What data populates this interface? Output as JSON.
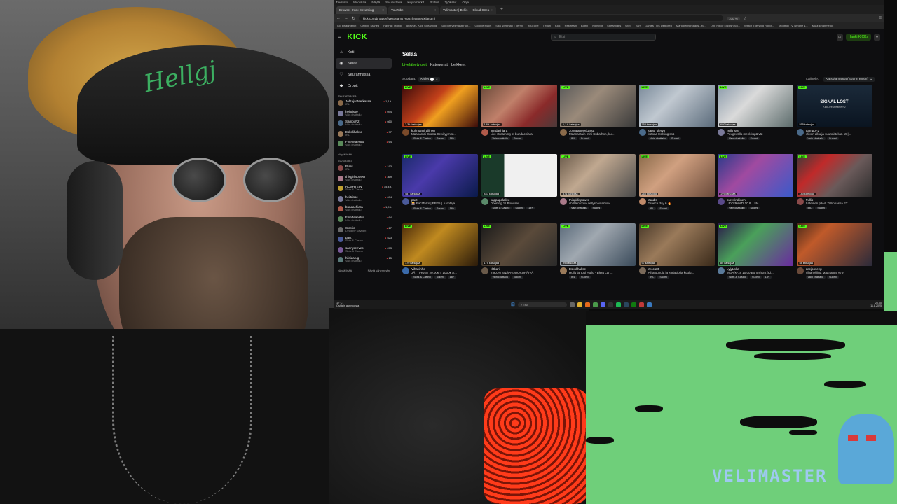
{
  "colors": {
    "kick_green": "#53fc18",
    "live_bg": "#53fc18",
    "bg": "#0e0e10",
    "game_green": "#6fcf7a"
  },
  "webcam": {
    "cap_text": "Hellgj"
  },
  "game": {
    "watermark": "VELIMASTER"
  },
  "browser": {
    "menu": [
      "Tiedosto",
      "Muokkaa",
      "Näytä",
      "Sivuhistoria",
      "Kirjanmerkit",
      "Profiilit",
      "Työkalut",
      "Ohje"
    ],
    "tabs": [
      {
        "label": "Browse - Kick Streaming",
        "active": true
      },
      {
        "label": "YouTube",
        "active": false
      },
      {
        "label": "Velimaster | Bellis — Cloud Strea",
        "active": false
      }
    ],
    "url": "kick.com/browse/livestreams?sort=featured&lang=fi",
    "zoom": "100 %",
    "bookmarks": [
      "Tuo kirjanmerkit",
      "Getting Started",
      "PayPal: Mobilli",
      "Browse - Kick Streaming",
      "Support velimaster on...",
      "Google Maps",
      "Siku Webmail :: Termit",
      "YouTube",
      "Twitch",
      "Kick",
      "Restream",
      "Botrix",
      "Nightbot",
      "Streamlabs",
      "OBS",
      "Yarr",
      "Games | US Detected",
      "Mariopelinurkkaus - Ki...",
      "One Piece English Su...",
      "Watch The Wild Robot...",
      "Moottori TV / Anime s...",
      "Muut kirjanmerkit"
    ]
  },
  "kick": {
    "logo": "KICK",
    "search_placeholder": "Etsi",
    "get_kicks": "Hanki KICKs",
    "nav": [
      {
        "label": "Koti",
        "icon": "home-icon",
        "glyph": "⌂"
      },
      {
        "label": "Selaa",
        "icon": "compass-icon",
        "glyph": "◉"
      },
      {
        "label": "Seurannassa",
        "icon": "heart-icon",
        "glyph": "♡"
      },
      {
        "label": "Dropit",
        "icon": "gift-icon",
        "glyph": "◆"
      }
    ],
    "following_heading": "Seurannassa",
    "following": [
      {
        "name": "JohtajanMetkassa",
        "cat": "IRL",
        "viewers": "1,1 t.",
        "color": "#8a6a4a"
      },
      {
        "name": "heiltrisse",
        "cat": "Vain chattailu",
        "viewers": "694",
        "color": "#7a7a9a"
      },
      {
        "name": "SampoF2",
        "cat": "Vain chattailu",
        "viewers": "660",
        "color": "#4a6a8a"
      },
      {
        "name": "Eskolihakse",
        "cat": "IRL",
        "viewers": "97",
        "color": "#9a7a5a"
      },
      {
        "name": "FinetMaestro",
        "cat": "Vain chattailu",
        "viewers": "64",
        "color": "#5a8a5a"
      }
    ],
    "show_more": "Näytä lisää",
    "recommended_heading": "Suositellut",
    "recommended": [
      {
        "name": "Pullis",
        "cat": "IRL",
        "viewers": "193",
        "color": "#8a4a4a"
      },
      {
        "name": "thisgirlispower",
        "cat": "Vain chattailu",
        "viewers": "369",
        "color": "#aa7a8a"
      },
      {
        "name": "ROSHTEIN",
        "cat": "Slots & Casino",
        "viewers": "15,4 t.",
        "color": "#c0a030"
      },
      {
        "name": "heiltrisse",
        "cat": "Vain chattailu",
        "viewers": "694",
        "color": "#7a7a9a"
      },
      {
        "name": "bundachiara",
        "cat": "Vain chattailu",
        "viewers": "1,9 t.",
        "color": "#b05a4a"
      },
      {
        "name": "FinetMaestro",
        "cat": "Vain chattailu",
        "viewers": "64",
        "color": "#5a8a5a"
      },
      {
        "name": "Sicotic",
        "cat": "Dead By Daylight",
        "viewers": "27",
        "color": "#6a6a6a"
      },
      {
        "name": "pact",
        "cat": "Slots & Casino",
        "viewers": "523",
        "color": "#4a5a9a"
      },
      {
        "name": "sannyreeves",
        "cat": "Slots & Casino",
        "viewers": "673",
        "color": "#7a5a9a"
      },
      {
        "name": "hiisidarug",
        "cat": "Vain chattailu",
        "viewers": "15",
        "color": "#5a7a7a"
      }
    ],
    "sidebar_footer_left": "Näytä lisää",
    "sidebar_footer_right": "Näytä vähemmän",
    "page_title": "Selaa",
    "main_tabs": [
      {
        "label": "Livelähetykset",
        "active": true
      },
      {
        "label": "Kategoriat",
        "active": false
      },
      {
        "label": "Leikkeet",
        "active": false
      }
    ],
    "filter_label": "Suodata:",
    "filter_value": "Kielet",
    "filter_count": "1",
    "sort_label": "Lajittele:",
    "sort_value": "Katsojamäärä (Suurin ensin)",
    "live_label": "LIVE",
    "streams": [
      {
        "viewers": "2,3 t. katsojaa",
        "name": "kuhmanvirallinen",
        "title": "Maanantai Erosta Selvityymist...",
        "tags": [
          "Slots & Casino",
          "Suomi",
          "18+"
        ],
        "thumb": "linear-gradient(135deg,#3a0a0a,#c2401a 40%,#f0a020 55%,#3a0a0a)",
        "av": "#7a4a2a"
      },
      {
        "viewers": "1,8 t. katsojaa",
        "name": "bundachiara",
        "title": "Live streaming of bundachiara",
        "tags": [
          "Vain chattailu",
          "Suomi"
        ],
        "thumb": "linear-gradient(135deg,#6a4a3a,#c0806a 40%,#8a2a2a 70%,#4a3a3a)",
        "av": "#b05a4a"
      },
      {
        "viewers": "1,1 t. katsojaa",
        "name": "JohtajanMetkassa",
        "title": "Maanantain mini Subathon, ku...",
        "tags": [
          "IRL",
          "Suomi"
        ],
        "thumb": "linear-gradient(135deg,#5a5a5a,#9a8a7a 40%,#3a3a3a)",
        "av": "#8a6a4a"
      },
      {
        "viewers": "758 katsojaa",
        "name": "sapo_olervo",
        "title": "kotona Helsingissä",
        "tags": [
          "Vain chattailu",
          "Suomi"
        ],
        "thumb": "linear-gradient(135deg,#7a8a9a,#c0c8d0 40%,#5a6a7a)",
        "av": "#4a6a8a"
      },
      {
        "viewers": "600 katsojaa",
        "name": "heiltrisse",
        "title": "Peugeotilla menkkapäivät",
        "tags": [
          "Vain chattailu",
          "Suomi"
        ],
        "thumb": "linear-gradient(135deg,#8a9aaa,#dadada 40%,#5a6a6a)",
        "av": "#7a7a9a"
      },
      {
        "viewers": "555 katsojaa",
        "name": "SampoF2",
        "title": "Viikon alku ja suunnittelua. W |...",
        "tags": [
          "Vain chattailu",
          "Suomi"
        ],
        "thumb": "linear-gradient(180deg,#1b2a3a,#0a1420)",
        "av": "#4a6a8a",
        "signal_lost": true,
        "sl_title": "SIGNAL LOST",
        "sl_sub": "KickLiveStreamerF2"
      },
      {
        "viewers": "487 katsojaa",
        "name": "pact",
        "title": "🎰 PactTalks | EP.25 | Juontaja...",
        "tags": [
          "Slots & Casino",
          "Suomi",
          "18+"
        ],
        "thumb": "linear-gradient(135deg,#1a2a6a,#4a3aaa 40%,#0a1a4a)",
        "av": "#4a5a9a"
      },
      {
        "viewers": "447 katsojaa",
        "name": "pappapelailee",
        "title": "Opening 11 Bonuses",
        "tags": [
          "Slots & Casino",
          "Suomi",
          "18+"
        ],
        "thumb": "linear-gradient(90deg,#1a3a2a 0 30%,#f0f0f0 30% 100%)",
        "av": "#5a8a6a"
      },
      {
        "viewers": "371 katsojaa",
        "name": "thisgirlispower",
        "title": "chillilentoo w cellyscootervow",
        "tags": [
          "Vain chattailu",
          "Suomi"
        ],
        "thumb": "linear-gradient(135deg,#6a5a4a,#c0a890 40%,#4a4a4a)",
        "av": "#aa7a8a"
      },
      {
        "viewers": "268 katsojaa",
        "name": "Jandis",
        "title": "Greece day 6 🔥",
        "tags": [
          "IRL",
          "Suomi"
        ],
        "thumb": "linear-gradient(135deg,#8a6a4a,#d0a080 40%,#6a4a3a)",
        "av": "#c08a6a"
      },
      {
        "viewers": "199 katsojaa",
        "name": "purevirallinen",
        "title": "LEVYRAATI 10.8. | !dc",
        "tags": [
          "Vain chattailu",
          "Suomi"
        ],
        "thumb": "linear-gradient(135deg,#2a3a8a,#a04aa0 40%,#3a5aca)",
        "av": "#5a4a8a"
      },
      {
        "viewers": "180 katsojaa",
        "name": "Pullis",
        "title": "Sateinen päivä Tallinnassa FT ...",
        "tags": [
          "IRL",
          "Suomi"
        ],
        "thumb": "linear-gradient(135deg,#3a3a3a,#c02a2a 30%,#6a5a5a 60%,#2a2a2a)",
        "av": "#8a4a4a"
      },
      {
        "viewers": "179 katsojaa",
        "name": "Vihavinho",
        "title": "JÄTTIHUNT 20.00€ = 1000€ A...",
        "tags": [
          "Slots & Casino",
          "Suomi",
          "18+"
        ],
        "thumb": "linear-gradient(135deg,#4a2a0a,#c08a20 40%,#2a1a0a)",
        "av": "#3a6aaa"
      },
      {
        "viewers": "175 katsojaa",
        "name": "elitbari",
        "title": "VIIKON SNÄPPIJUORUPÄIVÄ",
        "tags": [
          "Vain chattailu",
          "Suomi"
        ],
        "thumb": "linear-gradient(135deg,#1a1a1a,#5a4a3a 50%,#2a2a2a)",
        "av": "#6a5a4a"
      },
      {
        "viewers": "99 katsojaa",
        "name": "Eskolihakse",
        "title": "Huilu ja Tosi Hullu - Bleet Län...",
        "tags": [
          "IRL",
          "Suomi"
        ],
        "thumb": "linear-gradient(135deg,#5a6a7a,#a0a8b0 40%,#3a4a5a)",
        "av": "#9a7a5a"
      },
      {
        "viewers": "97 katsojaa",
        "name": "Jecca85",
        "title": "Pihatouhuja ja korjauksia koulu...",
        "tags": [
          "IRL",
          "Suomi"
        ],
        "thumb": "linear-gradient(135deg,#4a3a2a,#9a7a5a 40%,#3a2a1a)",
        "av": "#7a6a5a"
      },
      {
        "viewers": "80 katsojaa",
        "name": "LyjyLoka",
        "title": "MGA/K-18 10.00 Bonushunt (Ki...",
        "tags": [
          "Slots & Casino",
          "Suomi",
          "18+"
        ],
        "thumb": "linear-gradient(135deg,#2a1a4a,#4aa05a 40%,#6a2aa0)",
        "av": "#5a7a9a"
      },
      {
        "viewers": "58 katsojaa",
        "name": "deejooseep",
        "title": "Vihahelliina Maanantai #79",
        "tags": [
          "Vain chattailu",
          "Suomi"
        ],
        "thumb": "linear-gradient(135deg,#4a2a1a,#c05a2a 30%,#2a2a3a)",
        "av": "#6a4a3a"
      }
    ]
  },
  "taskbar": {
    "weather_temp": "17°C",
    "weather_desc": "Osittain aurinkoista",
    "search": "Etsi",
    "time": "20.00",
    "date": "11.8.2025"
  }
}
